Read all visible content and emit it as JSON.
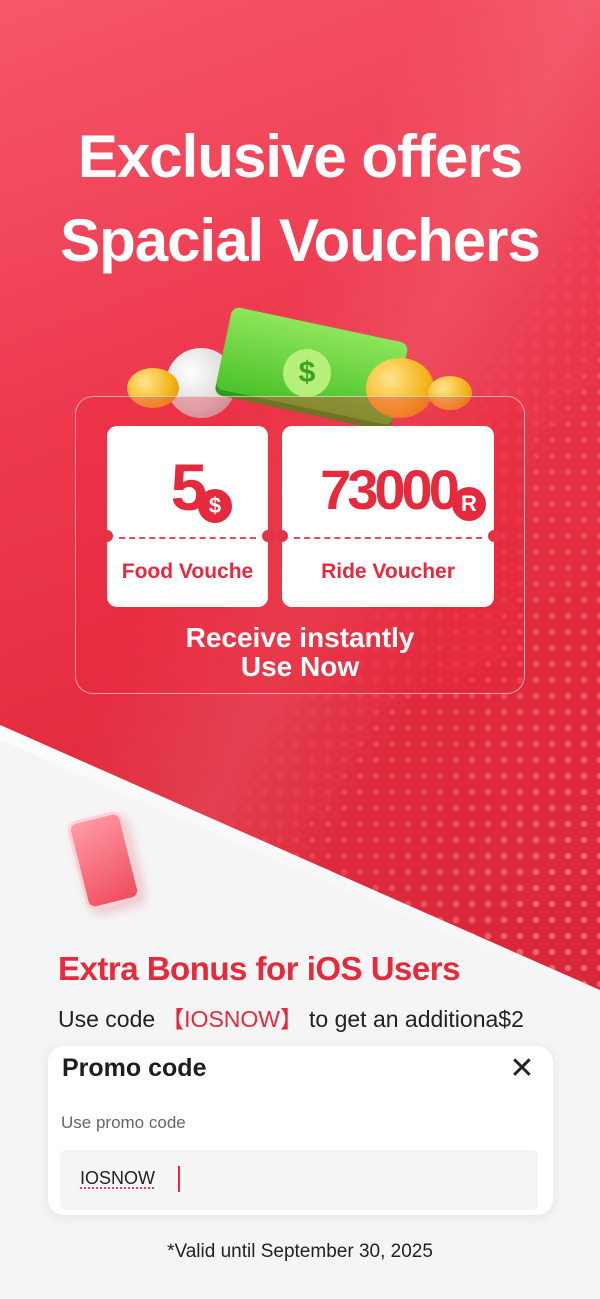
{
  "hero": {
    "title_line1": "Exclusive offers",
    "title_line2": "Spacial Vouchers"
  },
  "vouchers": [
    {
      "amount": "5",
      "currency_symbol": "$",
      "label": "Food Vouche"
    },
    {
      "amount": "73000",
      "currency_symbol": "R",
      "label": "Ride Voucher"
    }
  ],
  "cash_symbol": "$",
  "receive": {
    "line1": "Receive instantly",
    "line2": "Use Now"
  },
  "bonus": {
    "title": "Extra Bonus for iOS Users",
    "text_before": "Use code",
    "code": "【IOSNOW】",
    "text_after": "to get an additiona$2"
  },
  "promo": {
    "title": "Promo code",
    "close_symbol": "✕",
    "field_label": "Use promo code",
    "field_value": "IOSNOW"
  },
  "apple_symbol": "",
  "validity": "*Valid until September 30, 2025",
  "colors": {
    "brand_red": "#e42a3c",
    "background": "#f5f5f5"
  }
}
